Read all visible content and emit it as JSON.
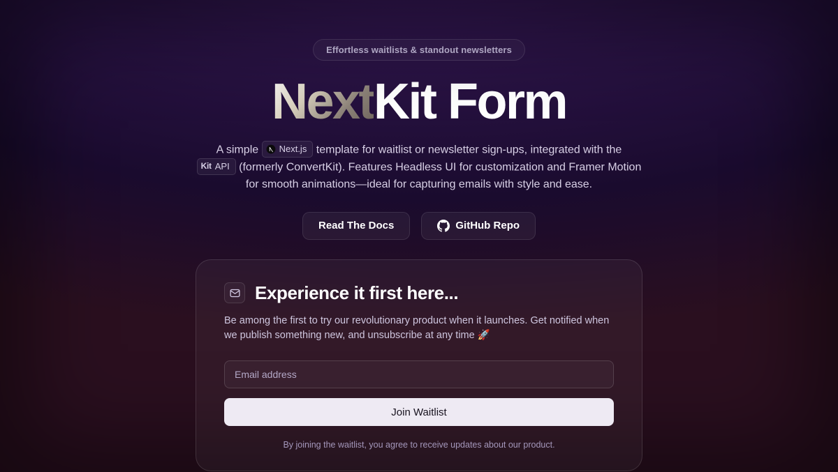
{
  "badge": "Effortless waitlists & standout newsletters",
  "title": {
    "next": "Next",
    "rest": "Kit Form"
  },
  "nextjs_pill": "Next.js",
  "kit_pill": {
    "kit": "Kit",
    "api": " API"
  },
  "desc": {
    "part1": "A simple ",
    "part2": " template for waitlist or newsletter sign-ups, integrated with the ",
    "part3": " (formerly ConvertKit). Features Headless UI for customization and Framer Motion for smooth animations—ideal for capturing emails with style and ease."
  },
  "buttons": {
    "docs": "Read The Docs",
    "github": "GitHub Repo"
  },
  "card": {
    "title": "Experience it first here...",
    "desc": "Be among the first to try our revolutionary product when it launches. Get notified when we publish something new, and unsubscribe at any time 🚀",
    "placeholder": "Email address",
    "submit": "Join Waitlist",
    "disclaimer": "By joining the waitlist, you agree to receive updates about our product."
  }
}
